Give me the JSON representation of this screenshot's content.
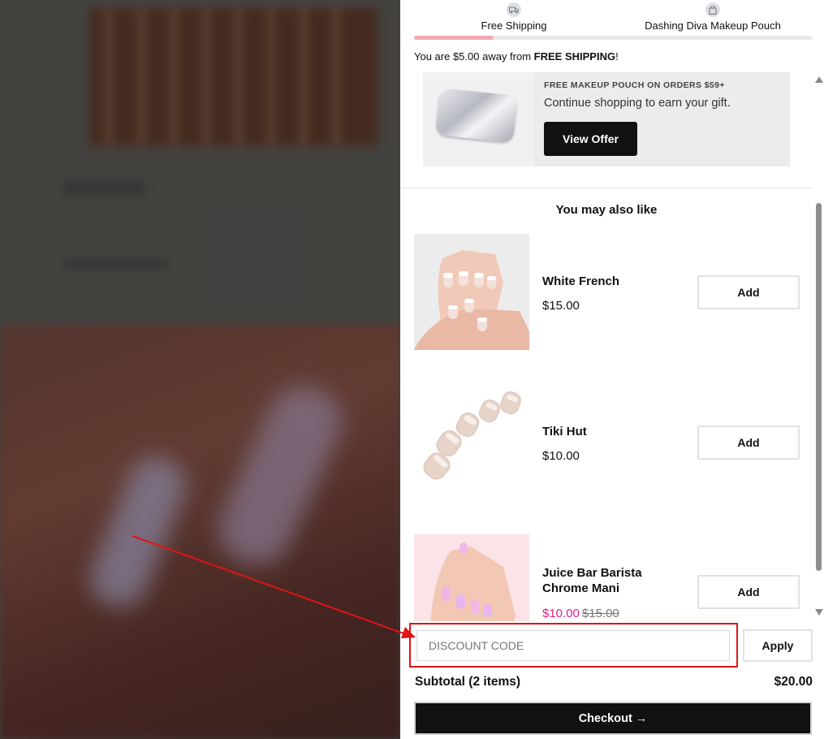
{
  "progress": {
    "milestones": [
      {
        "label": "Free Shipping",
        "icon": "truck-icon"
      },
      {
        "label": "Dashing Diva Makeup Pouch",
        "icon": "bag-icon"
      }
    ],
    "fill_fraction": 0.2,
    "away_prefix": "You are $5.00 away from ",
    "away_bold": "FREE SHIPPING",
    "away_suffix": "!"
  },
  "offer": {
    "kicker": "FREE MAKEUP POUCH ON ORDERS $59+",
    "description": "Continue shopping to earn your gift.",
    "button": "View Offer"
  },
  "recommendations": {
    "heading": "You may also like",
    "items": [
      {
        "name": "White French",
        "price": "$15.00",
        "add": "Add"
      },
      {
        "name": "Tiki Hut",
        "price": "$10.00",
        "add": "Add"
      },
      {
        "name": "Juice Bar Barista Chrome Mani",
        "price": "$10.00",
        "compare_price": "$15.00",
        "add": "Add"
      }
    ]
  },
  "discount": {
    "placeholder": "DISCOUNT CODE",
    "apply": "Apply"
  },
  "summary": {
    "subtotal_label": "Subtotal (2 items)",
    "subtotal_value": "$20.00",
    "checkout": "Checkout →"
  },
  "colors": {
    "progress_fill": "#f4a7b5",
    "sale_price": "#d6238f",
    "annotation": "#e01414"
  }
}
